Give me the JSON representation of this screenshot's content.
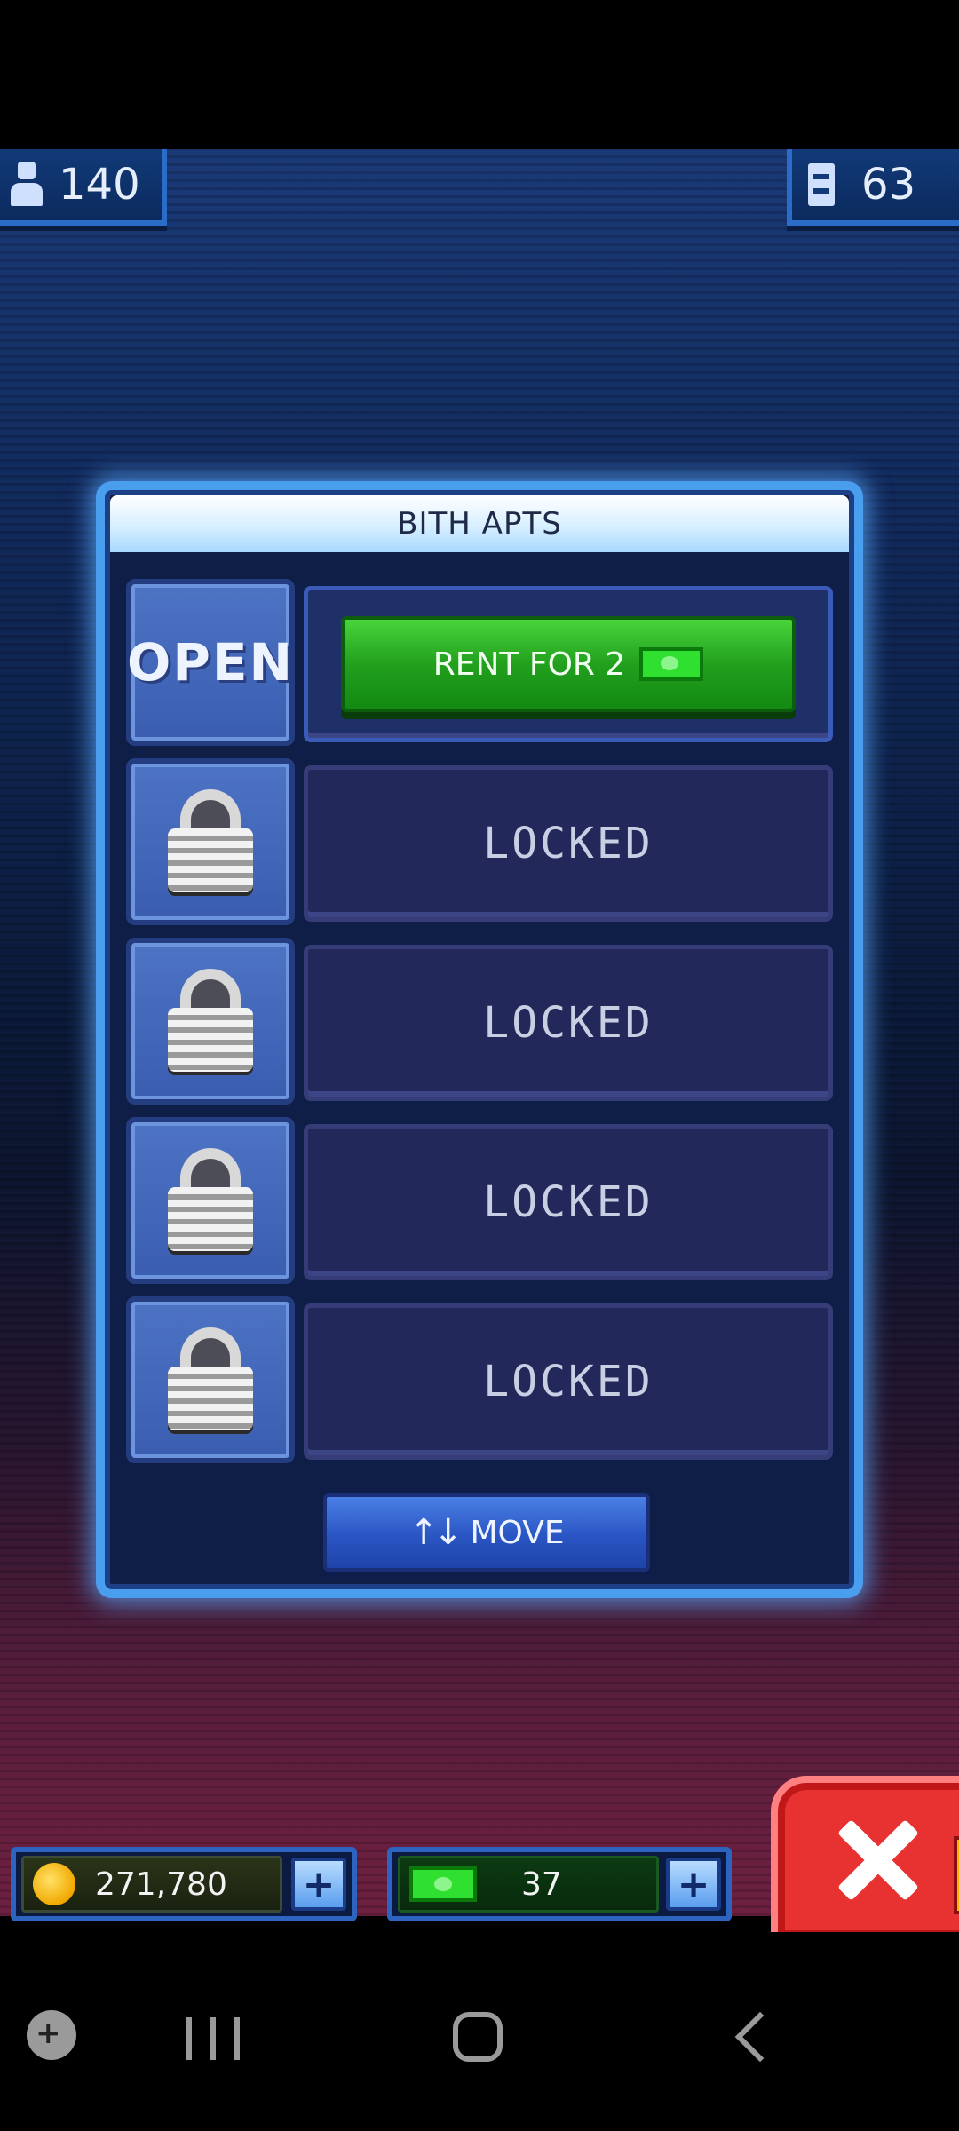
{
  "hud": {
    "population": "140",
    "floors": "63"
  },
  "panel": {
    "title": "BITH APTS",
    "open_label": "OPEN",
    "rent_label": "RENT FOR 2",
    "locked_label": "LOCKED",
    "move_label": "MOVE"
  },
  "currency": {
    "coins": "271,780",
    "bux": "37",
    "plus_symbol": "+"
  },
  "colors": {
    "panel_border": "#4a9eee",
    "rent_green": "#22a01e",
    "move_blue": "#2a55c4",
    "close_red": "#e83232"
  }
}
